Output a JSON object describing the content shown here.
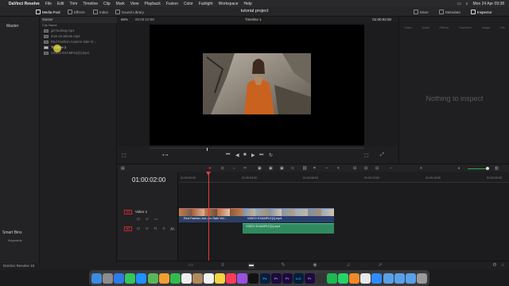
{
  "menubar": {
    "app_name": "DaVinci Resolve",
    "items": [
      "File",
      "Edit",
      "Trim",
      "Timeline",
      "Clip",
      "Mark",
      "View",
      "Playback",
      "Fusion",
      "Color",
      "Fairlight",
      "Workspace",
      "Help"
    ],
    "clock": "Mon 24 Apr 09:38"
  },
  "toolbar": {
    "media_pool": "Media Pool",
    "effects": "Effects",
    "index": "Index",
    "sound_library": "Sound Library",
    "project_title": "tutorial project",
    "mixer": "Mixer",
    "metadata": "Metadata",
    "inspector": "Inspector"
  },
  "sidebar": {
    "master": "Master",
    "smart_bins": "Smart Bins",
    "keywords": "Keywords"
  },
  "media_pool": {
    "bin_label": "Master",
    "column_header": "Clip Name",
    "clips": [
      {
        "name": "girl-looking.mp4",
        "selected": false
      },
      {
        "name": "man-on-phone.mp4",
        "selected": false
      },
      {
        "name": "Red Fashion Autumn Sale Vi...",
        "selected": false
      },
      {
        "name": "Timeline 1",
        "selected": true
      },
      {
        "name": "VIDEO EXAMPLE[1].mp4",
        "selected": false
      }
    ]
  },
  "viewer": {
    "zoom": "65%",
    "source_tc": "00:00:10:08",
    "timeline_name": "Timeline 1",
    "record_tc": "01:00:02:00"
  },
  "inspector": {
    "tabs": [
      "Video",
      "Audio",
      "Effects",
      "Transition",
      "Image",
      "File"
    ],
    "empty_message": "Nothing to inspect"
  },
  "timeline": {
    "timecode": "01:00:02:00",
    "ruler": [
      "01:00:00:00",
      "01:00:04:00",
      "01:00:08:00",
      "01:00:12:00",
      "01:00:16:00",
      "01:00:20:00"
    ],
    "v1": {
      "id": "V1",
      "name": "Video 1",
      "clip_a": "Red Fashion Aut..mn Sale Vid...",
      "clip_b": "VIDEO EXAMPLE[1].mp4"
    },
    "a1": {
      "id": "A1",
      "level": "2.0",
      "clip": "VIDEO EXAMPLE[1].mp4"
    }
  },
  "status": {
    "app_version": "DaVinci Resolve 18"
  },
  "dock_apps": [
    "Finder",
    "Launchpad",
    "Safari",
    "Messages",
    "Mail",
    "Maps",
    "Photos",
    "FaceTime",
    "Calendar",
    "Contacts",
    "Reminders",
    "Notes",
    "Music",
    "Podcasts",
    "TV",
    "Ps",
    "Pr",
    "Pr",
    "LrC",
    "Pr",
    "Resolve",
    "Spotify",
    "WhatsApp",
    "VLC",
    "Chrome",
    "Zoom",
    "Folder",
    "Folder",
    "Folder",
    "Trash"
  ]
}
